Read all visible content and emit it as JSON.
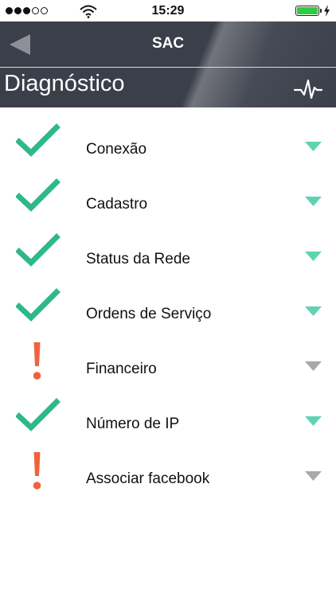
{
  "status_bar": {
    "time": "15:29",
    "signal_filled": 3,
    "signal_total": 5,
    "battery_level": 1.0
  },
  "header": {
    "nav_title": "SAC",
    "page_title": "Diagnóstico"
  },
  "colors": {
    "header_bg": "#3b3f4a",
    "ok": "#2fb88a",
    "warning": "#f0623e",
    "chevron_ok": "#5ed3b1",
    "chevron_muted": "#a9a9ab"
  },
  "items": [
    {
      "label": "Conexão",
      "status": "ok"
    },
    {
      "label": "Cadastro",
      "status": "ok"
    },
    {
      "label": "Status da Rede",
      "status": "ok"
    },
    {
      "label": "Ordens de Serviço",
      "status": "ok"
    },
    {
      "label": "Financeiro",
      "status": "warning"
    },
    {
      "label": "Número de IP",
      "status": "ok"
    },
    {
      "label": "Associar facebook",
      "status": "warning"
    }
  ],
  "icons": {
    "back": "back-arrow-icon",
    "pulse": "pulse-icon",
    "ok": "checkmark-icon",
    "warning": "exclamation-icon",
    "expand": "chevron-down-icon"
  }
}
